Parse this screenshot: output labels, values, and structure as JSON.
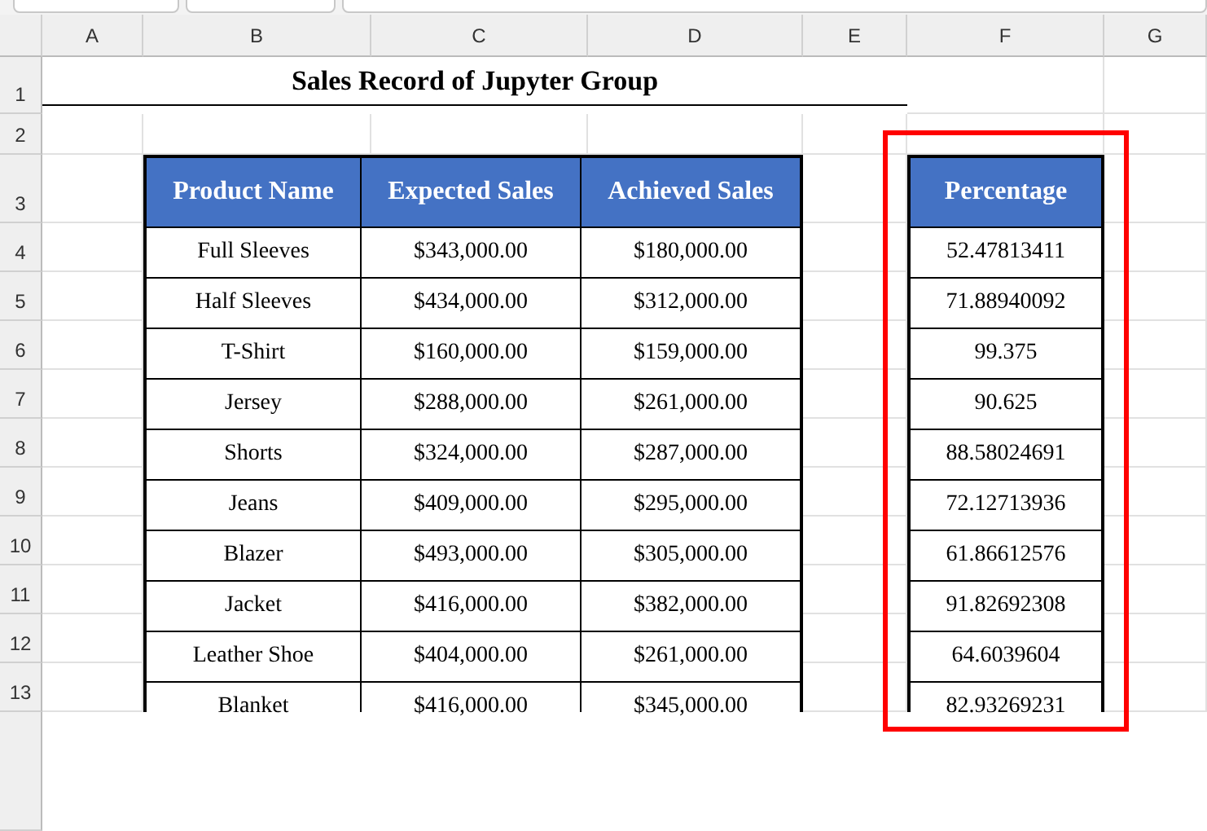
{
  "columns": [
    "A",
    "B",
    "C",
    "D",
    "E",
    "F",
    "G"
  ],
  "rows": [
    "1",
    "2",
    "3",
    "4",
    "5",
    "6",
    "7",
    "8",
    "9",
    "10",
    "11",
    "12",
    "13"
  ],
  "title": "Sales Record of Jupyter Group",
  "sales_table": {
    "columns": [
      "Product Name",
      "Expected Sales",
      "Achieved Sales"
    ],
    "rows": [
      [
        "Full Sleeves",
        "$343,000.00",
        "$180,000.00"
      ],
      [
        "Half Sleeves",
        "$434,000.00",
        "$312,000.00"
      ],
      [
        "T-Shirt",
        "$160,000.00",
        "$159,000.00"
      ],
      [
        "Jersey",
        "$288,000.00",
        "$261,000.00"
      ],
      [
        "Shorts",
        "$324,000.00",
        "$287,000.00"
      ],
      [
        "Jeans",
        "$409,000.00",
        "$295,000.00"
      ],
      [
        "Blazer",
        "$493,000.00",
        "$305,000.00"
      ],
      [
        "Jacket",
        "$416,000.00",
        "$382,000.00"
      ],
      [
        "Leather Shoe",
        "$404,000.00",
        "$261,000.00"
      ],
      [
        "Blanket",
        "$416,000.00",
        "$345,000.00"
      ]
    ]
  },
  "percentage_table": {
    "header": "Percentage",
    "highlighted": true,
    "values": [
      "52.47813411",
      "71.88940092",
      "99.375",
      "90.625",
      "88.58024691",
      "72.12713936",
      "61.86612576",
      "91.82692308",
      "64.6039604",
      "82.93269231"
    ]
  }
}
